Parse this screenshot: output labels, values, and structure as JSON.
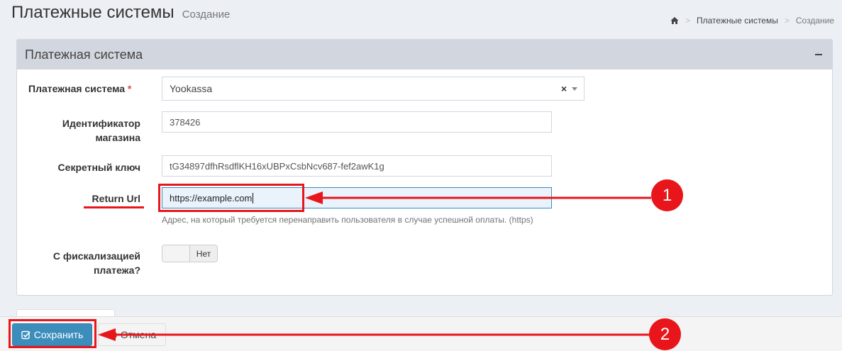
{
  "header": {
    "title": "Платежные системы",
    "subtitle": "Создание"
  },
  "breadcrumb": {
    "home_icon": "home-icon",
    "items": [
      "Платежные системы",
      "Создание"
    ]
  },
  "box": {
    "title": "Платежная система",
    "collapse_icon": "minus-icon"
  },
  "form": {
    "payment_system": {
      "label": "Платежная система",
      "required_mark": "*",
      "value": "Yookassa",
      "clear_glyph": "×"
    },
    "shop_id": {
      "label_line1": "Идентификатор",
      "label_line2": "магазина",
      "value": "378426"
    },
    "secret_key": {
      "label": "Секретный ключ",
      "value": "tG34897dfhRsdflKH16xUBPxCsbNcv687-fef2awK1g"
    },
    "return_url": {
      "label": "Return Url",
      "value": "https://example.com",
      "help": "Адрес, на который требуется перенаправить пользователя в случае успешной оплаты. (https)"
    },
    "fiscalization": {
      "label_line1": "С фискализацией",
      "label_line2": "платежа?",
      "toggle_label": "Нет"
    }
  },
  "footer": {
    "save_label": "Сохранить",
    "save_icon": "check-square-icon",
    "cancel_label": "Отмена",
    "cancel_icon": "circle-x-icon"
  },
  "annotations": {
    "badge1": "1",
    "badge2": "2",
    "color": "#e8161b"
  }
}
